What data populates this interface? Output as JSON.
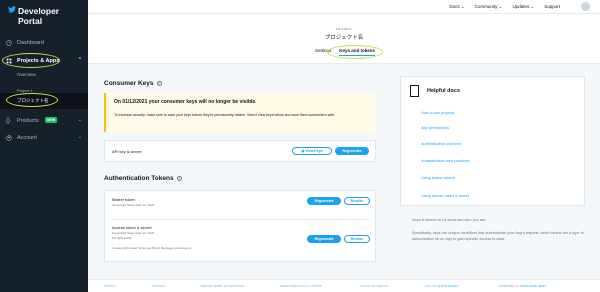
{
  "sidebar": {
    "logo": "Developer Portal",
    "dashboard": "Dashboard",
    "projects_apps": "Projects & Apps",
    "overview": "Overview",
    "project1": "Project 1",
    "project_name": "プロジェクト名",
    "products": "Products",
    "products_badge": "NEW",
    "account": "Account"
  },
  "topnav": {
    "docs": "Docs ⌄",
    "community": "Community ⌄",
    "updates": "Updates ⌄",
    "support": "Support"
  },
  "header": {
    "project_label": "PROJECT",
    "project_title": "プロジェクト名",
    "tab_settings": "Settings",
    "tab_keys": "Keys and tokens"
  },
  "consumer_keys": {
    "title": "Consumer Keys",
    "warning_title": "On 01/12/2021 your consumer keys will no longer be visible.",
    "warning_body": "To increase security, make sure to save your keys before they're permanently hidden. Select View keys below and save them somewhere safe.",
    "api_key_label": "API key & secret",
    "view_keys": "View Keys",
    "regenerate": "Regenerate"
  },
  "auth_tokens": {
    "title": "Authentication Tokens",
    "bearer_label": "Bearer token",
    "bearer_meta": "Generated September 12, 2020",
    "regenerate": "Regenerate",
    "revoke": "Revoke",
    "access_label": "Access token & secret",
    "access_meta1": "Generated September 12, 2020",
    "access_meta2": "For @h11223y",
    "access_meta3": "Created with Read, Write and Direct Messages permissions"
  },
  "help": {
    "title": "Helpful docs",
    "links": [
      "How to use projects",
      "App permissions",
      "Authentication overview",
      "Authentication best practices",
      "Using bearer tokens",
      "Using access token & secret"
    ],
    "text1": "Keys & tokens let us know you who you are.",
    "text2": "Specifically, keys are unique identifiers that authenticate your App's request, while tokens are a type of authorization for an App to gain specific access to data."
  },
  "footer": {
    "privacy": "PRIVACY",
    "cookies": "COOKIES",
    "terms": "TWITTER TERMS & CONDITIONS",
    "policy": "DEVELOPER POLICY & TERMS",
    "copyright": "© 2020 TWITTER INC.",
    "follow": "FOLLOW",
    "follow_handle": "@TWITTERDEV",
    "subscribe": "SUBSCRIBE TO",
    "subscribe_target": "DEVELOPER NEWS"
  },
  "colors": {
    "accent": "#1da1f2",
    "sidebar": "#15202b",
    "highlight_circle": "#c5e34d"
  }
}
